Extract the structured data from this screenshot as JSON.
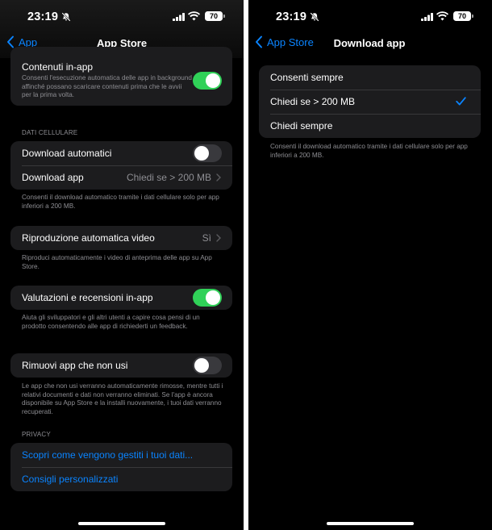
{
  "status": {
    "time": "23:19",
    "battery": "70"
  },
  "left": {
    "back_label": "App",
    "title": "App Store",
    "inapp": {
      "label": "Contenuti in-app",
      "desc": "Consenti l'esecuzione automatica delle app in background affinché possano scaricare contenuti prima che le avvii per la prima volta.",
      "on": true
    },
    "cellular_header": "DATI CELLULARE",
    "auto_download": {
      "label": "Download automatici",
      "on": false
    },
    "download_app": {
      "label": "Download app",
      "value": "Chiedi se > 200 MB"
    },
    "cellular_desc": "Consenti il download automatico tramite i dati cellulare solo per app inferiori a 200 MB.",
    "video": {
      "label": "Riproduzione automatica video",
      "value": "Sì"
    },
    "video_desc": "Riproduci automaticamente i video di anteprima delle app su App Store.",
    "ratings": {
      "label": "Valutazioni e recensioni in-app",
      "on": true
    },
    "ratings_desc": "Aiuta gli sviluppatori e gli altri utenti a capire cosa pensi di un prodotto consentendo alle app di richiederti un feedback.",
    "offload": {
      "label": "Rimuovi app che non usi",
      "on": false
    },
    "offload_desc": "Le app che non usi verranno automaticamente rimosse, mentre tutti i relativi documenti e dati non verranno eliminati. Se l'app è ancora disponibile su App Store e la installi nuovamente, i tuoi dati verranno recuperati.",
    "privacy_header": "PRIVACY",
    "privacy_link1": "Scopri come vengono gestiti i tuoi dati...",
    "privacy_link2": "Consigli personalizzati"
  },
  "right": {
    "back_label": "App Store",
    "title": "Download app",
    "options": [
      {
        "label": "Consenti sempre",
        "selected": false
      },
      {
        "label": "Chiedi se > 200 MB",
        "selected": true
      },
      {
        "label": "Chiedi sempre",
        "selected": false
      }
    ],
    "desc": "Consenti il download automatico tramite i dati cellulare solo per app inferiori a 200 MB."
  },
  "colors": {
    "accent": "#0a84ff",
    "toggle_on": "#30d158",
    "card": "#1c1c1e"
  }
}
